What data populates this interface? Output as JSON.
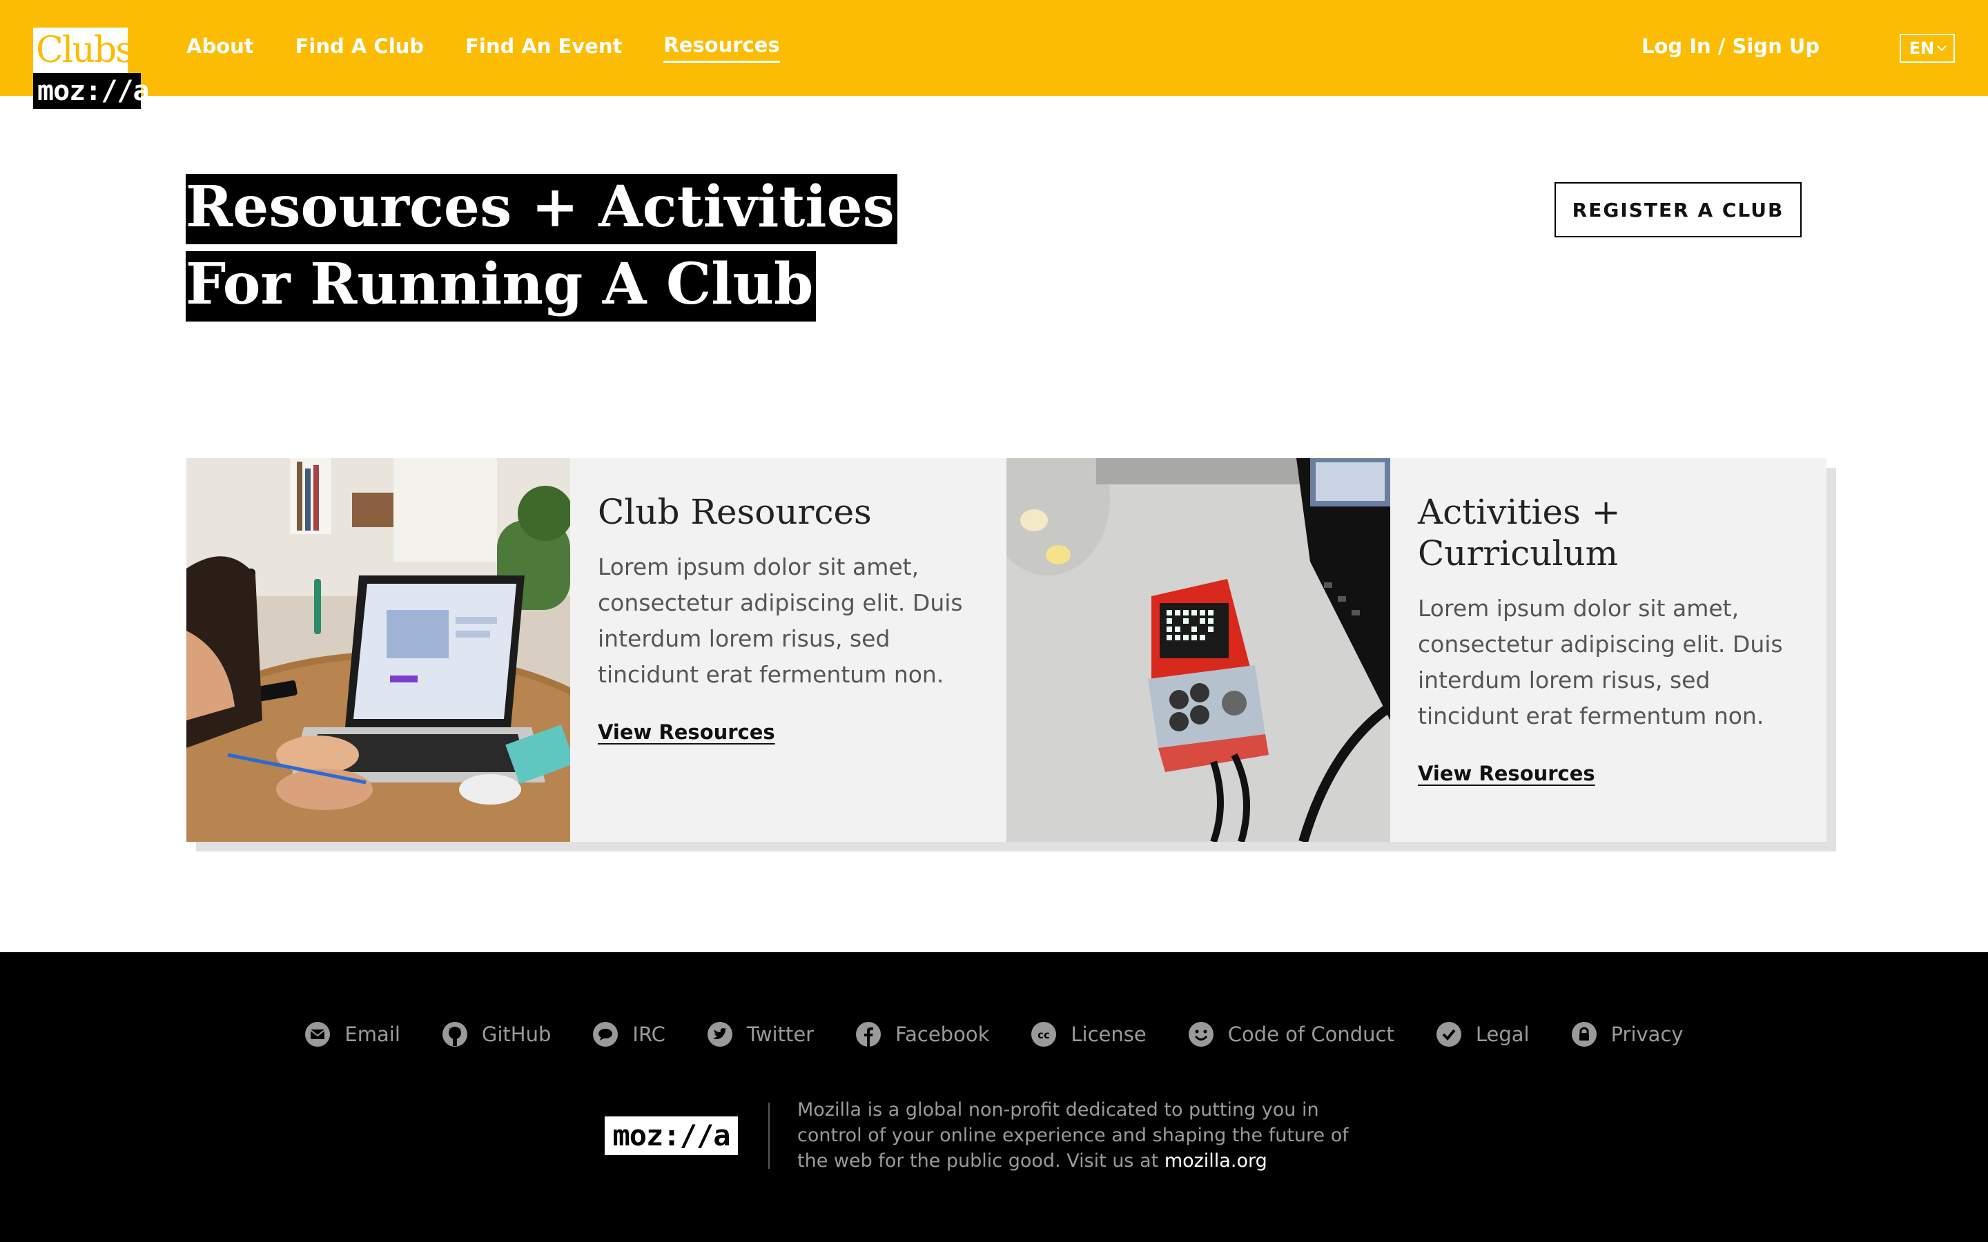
{
  "header": {
    "logo_top": "Clubs",
    "logo_bottom": "moz://a",
    "nav": [
      {
        "label": "About"
      },
      {
        "label": "Find A Club"
      },
      {
        "label": "Find An Event"
      },
      {
        "label": "Resources",
        "active": true
      }
    ],
    "login_label": "Log In / Sign Up",
    "language": "EN"
  },
  "hero": {
    "title_line1": "Resources + Activities",
    "title_line2": "For Running A Club",
    "register_label": "REGISTER A CLUB"
  },
  "cards": [
    {
      "title": "Club Resources",
      "body": "Lorem ipsum dolor sit amet, consectetur adipiscing elit. Duis interdum lorem risus, sed tincidunt erat fermentum non.",
      "link": "View Resources"
    },
    {
      "title": "Activities + Curriculum",
      "body": "Lorem ipsum dolor sit amet, consectetur adipiscing elit. Duis interdum lorem risus, sed tincidunt erat fermentum non.",
      "link": "View Resources"
    }
  ],
  "footer": {
    "links": [
      {
        "label": "Email",
        "icon": "email-icon"
      },
      {
        "label": "GitHub",
        "icon": "github-icon"
      },
      {
        "label": "IRC",
        "icon": "chat-icon"
      },
      {
        "label": "Twitter",
        "icon": "twitter-icon"
      },
      {
        "label": "Facebook",
        "icon": "facebook-icon"
      },
      {
        "label": "License",
        "icon": "creative-commons-icon"
      },
      {
        "label": "Code of Conduct",
        "icon": "smiley-icon"
      },
      {
        "label": "Legal",
        "icon": "checkmark-icon"
      },
      {
        "label": "Privacy",
        "icon": "lock-icon"
      }
    ],
    "logo": "moz://a",
    "tagline": "Mozilla is a global non-profit dedicated to putting you in control of your online experience and shaping the future of the web for the public good. Visit us at",
    "url": "mozilla.org"
  },
  "colors": {
    "brand_yellow": "#fbbc03",
    "footer_bg": "#000000",
    "card_bg": "#f2f2f2"
  }
}
